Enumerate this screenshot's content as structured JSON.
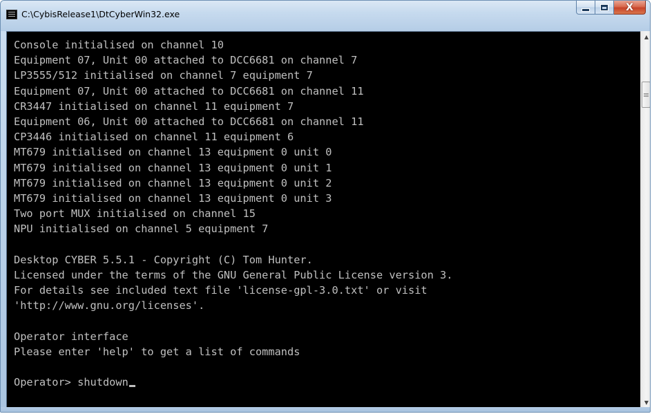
{
  "window": {
    "title": "C:\\CybisRelease1\\DtCyberWin32.exe"
  },
  "caption_buttons": {
    "minimize_icon": "minimize-icon",
    "maximize_icon": "maximize-icon",
    "close_glyph": "X"
  },
  "console": {
    "lines": [
      "Console initialised on channel 10",
      "Equipment 07, Unit 00 attached to DCC6681 on channel 7",
      "LP3555/512 initialised on channel 7 equipment 7",
      "Equipment 07, Unit 00 attached to DCC6681 on channel 11",
      "CR3447 initialised on channel 11 equipment 7",
      "Equipment 06, Unit 00 attached to DCC6681 on channel 11",
      "CP3446 initialised on channel 11 equipment 6",
      "MT679 initialised on channel 13 equipment 0 unit 0",
      "MT679 initialised on channel 13 equipment 0 unit 1",
      "MT679 initialised on channel 13 equipment 0 unit 2",
      "MT679 initialised on channel 13 equipment 0 unit 3",
      "Two port MUX initialised on channel 15",
      "NPU initialised on channel 5 equipment 7",
      "",
      "Desktop CYBER 5.5.1 - Copyright (C) Tom Hunter.",
      "Licensed under the terms of the GNU General Public License version 3.",
      "For details see included text file 'license-gpl-3.0.txt' or visit",
      "'http://www.gnu.org/licenses'.",
      "",
      "Operator interface",
      "Please enter 'help' to get a list of commands",
      ""
    ],
    "prompt": "Operator> ",
    "input": "shutdown",
    "text_color": "#c0c0c0",
    "background_color": "#000000"
  },
  "scrollbar": {
    "up_arrow": "▲",
    "down_arrow": "▼"
  }
}
